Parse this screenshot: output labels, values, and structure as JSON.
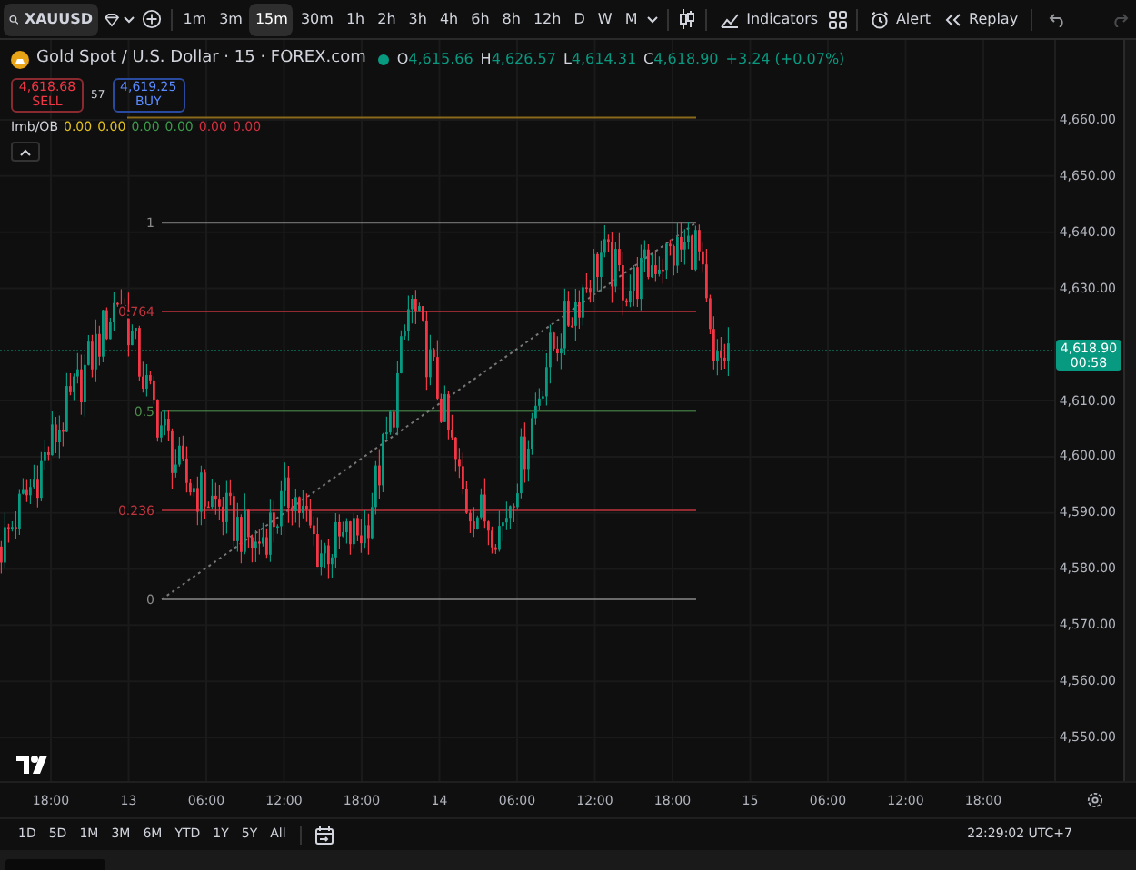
{
  "toolbar": {
    "symbol": "XAUUSD",
    "intervals": [
      {
        "label": "1m",
        "selected": false
      },
      {
        "label": "3m",
        "selected": false
      },
      {
        "label": "15m",
        "selected": true
      },
      {
        "label": "30m",
        "selected": false
      },
      {
        "label": "1h",
        "selected": false
      },
      {
        "label": "2h",
        "selected": false
      },
      {
        "label": "3h",
        "selected": false
      },
      {
        "label": "4h",
        "selected": false
      },
      {
        "label": "6h",
        "selected": false
      },
      {
        "label": "8h",
        "selected": false
      },
      {
        "label": "12h",
        "selected": false
      },
      {
        "label": "D",
        "selected": false
      },
      {
        "label": "W",
        "selected": false
      },
      {
        "label": "M",
        "selected": false
      }
    ],
    "indicators": "Indicators",
    "alert": "Alert",
    "replay": "Replay",
    "undo": {
      "disabled": false
    },
    "redo": {
      "disabled": true
    }
  },
  "legend": {
    "title": "Gold Spot / U.S. Dollar · 15 · FOREX.com",
    "ohlc": [
      {
        "key": "O",
        "value": "4,615.66"
      },
      {
        "key": "H",
        "value": "4,626.57"
      },
      {
        "key": "L",
        "value": "4,614.31"
      },
      {
        "key": "C",
        "value": "4,618.90"
      }
    ],
    "change": "+3.24 (+0.07%)",
    "sell": {
      "price": "4,618.68",
      "label": "SELL"
    },
    "spread": "57",
    "buy": {
      "price": "4,619.25",
      "label": "BUY"
    },
    "indicator": {
      "name": "Imb/OB",
      "values": [
        {
          "text": "0.00",
          "color": "#e0c020"
        },
        {
          "text": "0.00",
          "color": "#e0c020"
        },
        {
          "text": "0.00",
          "color": "#3a9a4a"
        },
        {
          "text": "0.00",
          "color": "#3a9a4a"
        },
        {
          "text": "0.00",
          "color": "#d03040"
        },
        {
          "text": "0.00",
          "color": "#d03040"
        }
      ]
    }
  },
  "chart": {
    "fib_levels": [
      {
        "label": "1",
        "color": "#8a8a8a"
      },
      {
        "label": "0.764",
        "color": "#c0343e"
      },
      {
        "label": "0.5",
        "color": "#4a8a4a"
      },
      {
        "label": "0.236",
        "color": "#c0343e"
      },
      {
        "label": "0",
        "color": "#8a8a8a"
      }
    ],
    "price_ticks": [
      "4,660.00",
      "4,650.00",
      "4,640.00",
      "4,630.00",
      "4,610.00",
      "4,600.00",
      "4,590.00",
      "4,580.00",
      "4,570.00",
      "4,560.00",
      "4,550.00"
    ],
    "current_price": {
      "price": "4,618.90",
      "countdown": "00:58"
    },
    "time_ticks": [
      "18:00",
      "13",
      "06:00",
      "12:00",
      "18:00",
      "14",
      "06:00",
      "12:00",
      "18:00",
      "15",
      "06:00",
      "12:00",
      "18:00"
    ]
  },
  "ranges": [
    "1D",
    "5D",
    "1M",
    "3M",
    "6M",
    "YTD",
    "1Y",
    "5Y",
    "All"
  ],
  "clock": "22:29:02 UTC+7"
}
